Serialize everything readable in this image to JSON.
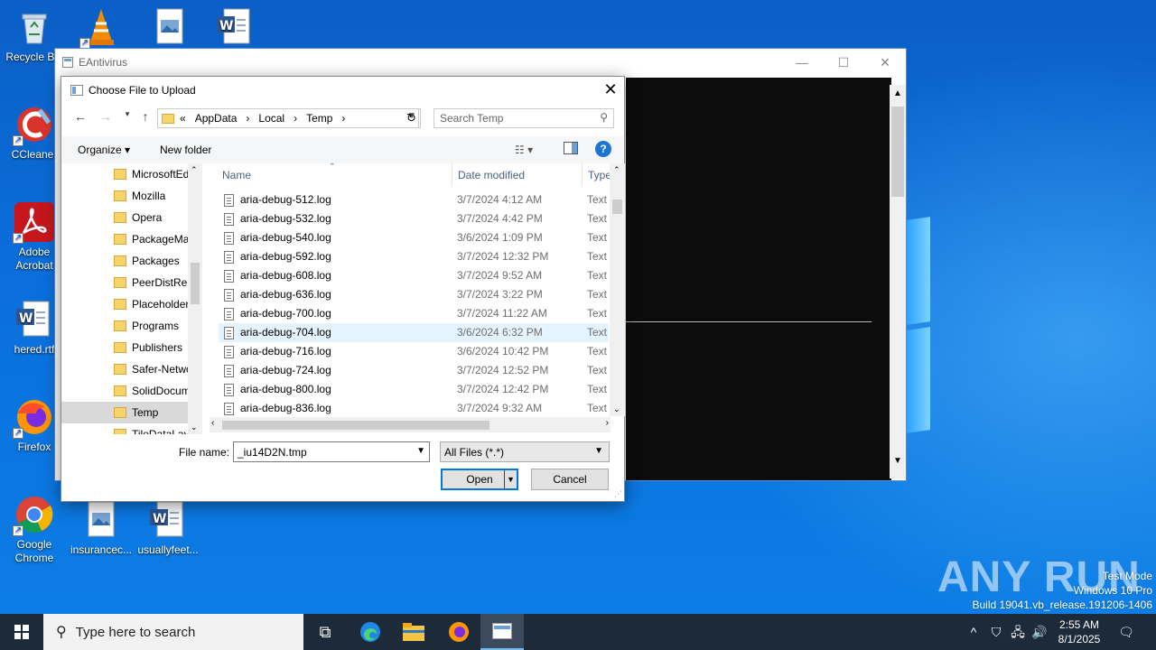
{
  "desktop": {
    "icons": [
      {
        "label": "Recycle Bin",
        "icon": "recycle-bin-icon"
      },
      {
        "label": "CCleaner",
        "icon": "ccleaner-icon"
      },
      {
        "label": "Adobe Acrobat",
        "icon": "adobe-acrobat-icon"
      },
      {
        "label": "hered.rtf",
        "icon": "word-document-icon"
      },
      {
        "label": "Firefox",
        "icon": "firefox-icon"
      },
      {
        "label": "Google Chrome",
        "icon": "chrome-icon"
      },
      {
        "label": "insurancec...",
        "icon": "image-file-icon"
      },
      {
        "label": "usuallyfeet...",
        "icon": "word-document-icon"
      }
    ]
  },
  "app_window": {
    "title": "EAntivirus",
    "minimize": "—",
    "maximize": "☐",
    "close": "✕"
  },
  "dialog": {
    "title": "Choose File to Upload",
    "close": "✕",
    "breadcrumb": [
      "«",
      "AppData",
      "›",
      "Local",
      "›",
      "Temp",
      "›"
    ],
    "search_placeholder": "Search Temp",
    "organize": "Organize ▾",
    "new_folder": "New folder",
    "nav_items": [
      {
        "label": "MicrosoftEd",
        "selected": false
      },
      {
        "label": "Mozilla",
        "selected": false
      },
      {
        "label": "Opera",
        "selected": false
      },
      {
        "label": "PackageMa",
        "selected": false
      },
      {
        "label": "Packages",
        "selected": false
      },
      {
        "label": "PeerDistRep",
        "selected": false
      },
      {
        "label": "Placeholder",
        "selected": false
      },
      {
        "label": "Programs",
        "selected": false
      },
      {
        "label": "Publishers",
        "selected": false
      },
      {
        "label": "Safer-Netwo",
        "selected": false
      },
      {
        "label": "SolidDocum",
        "selected": false
      },
      {
        "label": "Temp",
        "selected": true
      },
      {
        "label": "TileDataLay",
        "selected": false
      }
    ],
    "columns": {
      "name": "Name",
      "date": "Date modified",
      "type": "Type"
    },
    "files": [
      {
        "name": "aria-debug-512.log",
        "date": "3/7/2024 4:12 AM",
        "type": "Text",
        "selected": false
      },
      {
        "name": "aria-debug-532.log",
        "date": "3/7/2024 4:42 PM",
        "type": "Text",
        "selected": false
      },
      {
        "name": "aria-debug-540.log",
        "date": "3/6/2024 1:09 PM",
        "type": "Text",
        "selected": false
      },
      {
        "name": "aria-debug-592.log",
        "date": "3/7/2024 12:32 PM",
        "type": "Text",
        "selected": false
      },
      {
        "name": "aria-debug-608.log",
        "date": "3/7/2024 9:52 AM",
        "type": "Text",
        "selected": false
      },
      {
        "name": "aria-debug-636.log",
        "date": "3/7/2024 3:22 PM",
        "type": "Text",
        "selected": false
      },
      {
        "name": "aria-debug-700.log",
        "date": "3/7/2024 11:22 AM",
        "type": "Text",
        "selected": false
      },
      {
        "name": "aria-debug-704.log",
        "date": "3/6/2024 6:32 PM",
        "type": "Text",
        "selected": true
      },
      {
        "name": "aria-debug-716.log",
        "date": "3/6/2024 10:42 PM",
        "type": "Text",
        "selected": false
      },
      {
        "name": "aria-debug-724.log",
        "date": "3/7/2024 12:52 PM",
        "type": "Text",
        "selected": false
      },
      {
        "name": "aria-debug-800.log",
        "date": "3/7/2024 12:42 PM",
        "type": "Text",
        "selected": false
      },
      {
        "name": "aria-debug-836.log",
        "date": "3/7/2024 9:32 AM",
        "type": "Text",
        "selected": false
      }
    ],
    "file_name_label": "File name:",
    "file_name_value": "_iu14D2N.tmp",
    "file_type_filter": "All Files (*.*)",
    "open_button": "Open",
    "cancel_button": "Cancel"
  },
  "taskbar": {
    "search_placeholder": "Type here to search",
    "time": "2:55 AM",
    "date": "8/1/2025"
  },
  "watermark": {
    "line1": "Test Mode",
    "line2": "Windows 10 Pro",
    "line3": "Build 19041.vb_release.191206-1406",
    "brand": "ANY RUN"
  }
}
